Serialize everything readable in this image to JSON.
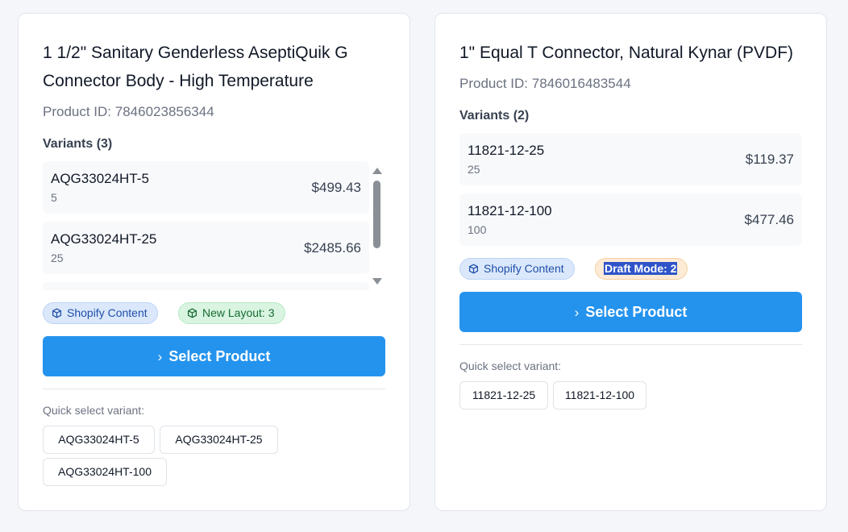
{
  "products": [
    {
      "title_line1": "1 1/2\" Sanitary Genderless AseptiQuik G",
      "title_line2": "Connector Body - High Temperature",
      "product_id": "Product ID: 7846023856344",
      "variants_label": "Variants (3)",
      "variants": [
        {
          "sku": "AQG33024HT-5",
          "sub": "5",
          "price": "$499.43"
        },
        {
          "sku": "AQG33024HT-25",
          "sub": "25",
          "price": "$2485.66"
        }
      ],
      "badges": [
        {
          "label": "Shopify Content",
          "icon": "package-icon"
        },
        {
          "label": "New Layout: 3",
          "icon": "package-icon"
        }
      ],
      "select_label": "Select Product",
      "quick_select_label": "Quick select variant:",
      "quick_select": [
        "AQG33024HT-5",
        "AQG33024HT-25",
        "AQG33024HT-100"
      ]
    },
    {
      "title_line1": "1\" Equal T Connector, Natural Kynar (PVDF)",
      "product_id": "Product ID: 7846016483544",
      "variants_label": "Variants (2)",
      "variants": [
        {
          "sku": "11821-12-25",
          "sub": "25",
          "price": "$119.37"
        },
        {
          "sku": "11821-12-100",
          "sub": "100",
          "price": "$477.46"
        }
      ],
      "badges": [
        {
          "label": "Shopify Content",
          "icon": "package-icon"
        },
        {
          "label": "Draft Mode: 2"
        }
      ],
      "select_label": "Select Product",
      "quick_select_label": "Quick select variant:",
      "quick_select": [
        "11821-12-25",
        "11821-12-100"
      ]
    }
  ],
  "colors": {
    "primary": "#2493ee",
    "badge_blue": "#dbe8fb",
    "badge_green": "#d9f5e1",
    "badge_orange": "#fdebd6"
  }
}
